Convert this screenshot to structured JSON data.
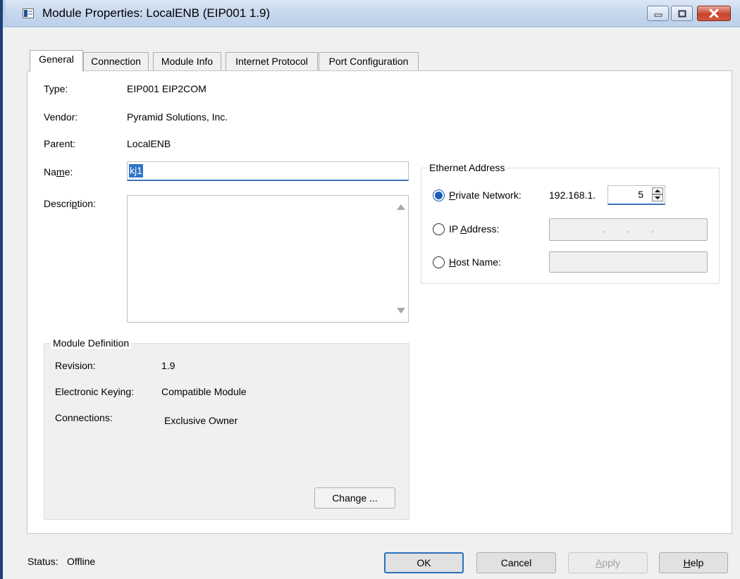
{
  "window": {
    "title": "Module Properties: LocalENB (EIP001 1.9)"
  },
  "tabs": [
    {
      "label": "General",
      "active": true
    },
    {
      "label": "Connection"
    },
    {
      "label": "Module Info"
    },
    {
      "label": "Internet Protocol"
    },
    {
      "label": "Port Configuration"
    }
  ],
  "general": {
    "type_label": "Type:",
    "type_value": "EIP001 EIP2COM",
    "vendor_label": "Vendor:",
    "vendor_value": "Pyramid Solutions, Inc.",
    "parent_label": "Parent:",
    "parent_value": "LocalENB",
    "name_label_pre": "Na",
    "name_label_accel": "m",
    "name_label_post": "e:",
    "name_value": "kj1",
    "description_label_pre": "Descri",
    "description_label_accel": "p",
    "description_label_post": "tion:",
    "description_value": ""
  },
  "module_definition": {
    "caption": "Module Definition",
    "revision_label": "Revision:",
    "revision_value": "1.9",
    "keying_label": "Electronic Keying:",
    "keying_value": "Compatible Module",
    "connections_label": "Connections:",
    "connections_value": "Exclusive Owner",
    "change_button": "Change ..."
  },
  "ethernet": {
    "caption": "Ethernet Address",
    "private_label_accel": "P",
    "private_label_post": "rivate Network:",
    "private_prefix": "192.168.1.",
    "private_octet": "5",
    "ip_label_pre": "IP ",
    "ip_label_accel": "A",
    "ip_label_post": "ddress:",
    "ip_placeholder": ".        .        .",
    "host_label_accel": "H",
    "host_label_post": "ost Name:",
    "host_value": "",
    "selected": "private"
  },
  "footer": {
    "status_label": "Status:",
    "status_value": "Offline",
    "ok": "OK",
    "cancel": "Cancel",
    "apply_accel": "A",
    "apply_post": "pply",
    "help_accel": "H",
    "help_post": "elp"
  },
  "colors": {
    "accent": "#1d5fb2",
    "selection": "#3173c6",
    "close_button": "#c7432c"
  }
}
